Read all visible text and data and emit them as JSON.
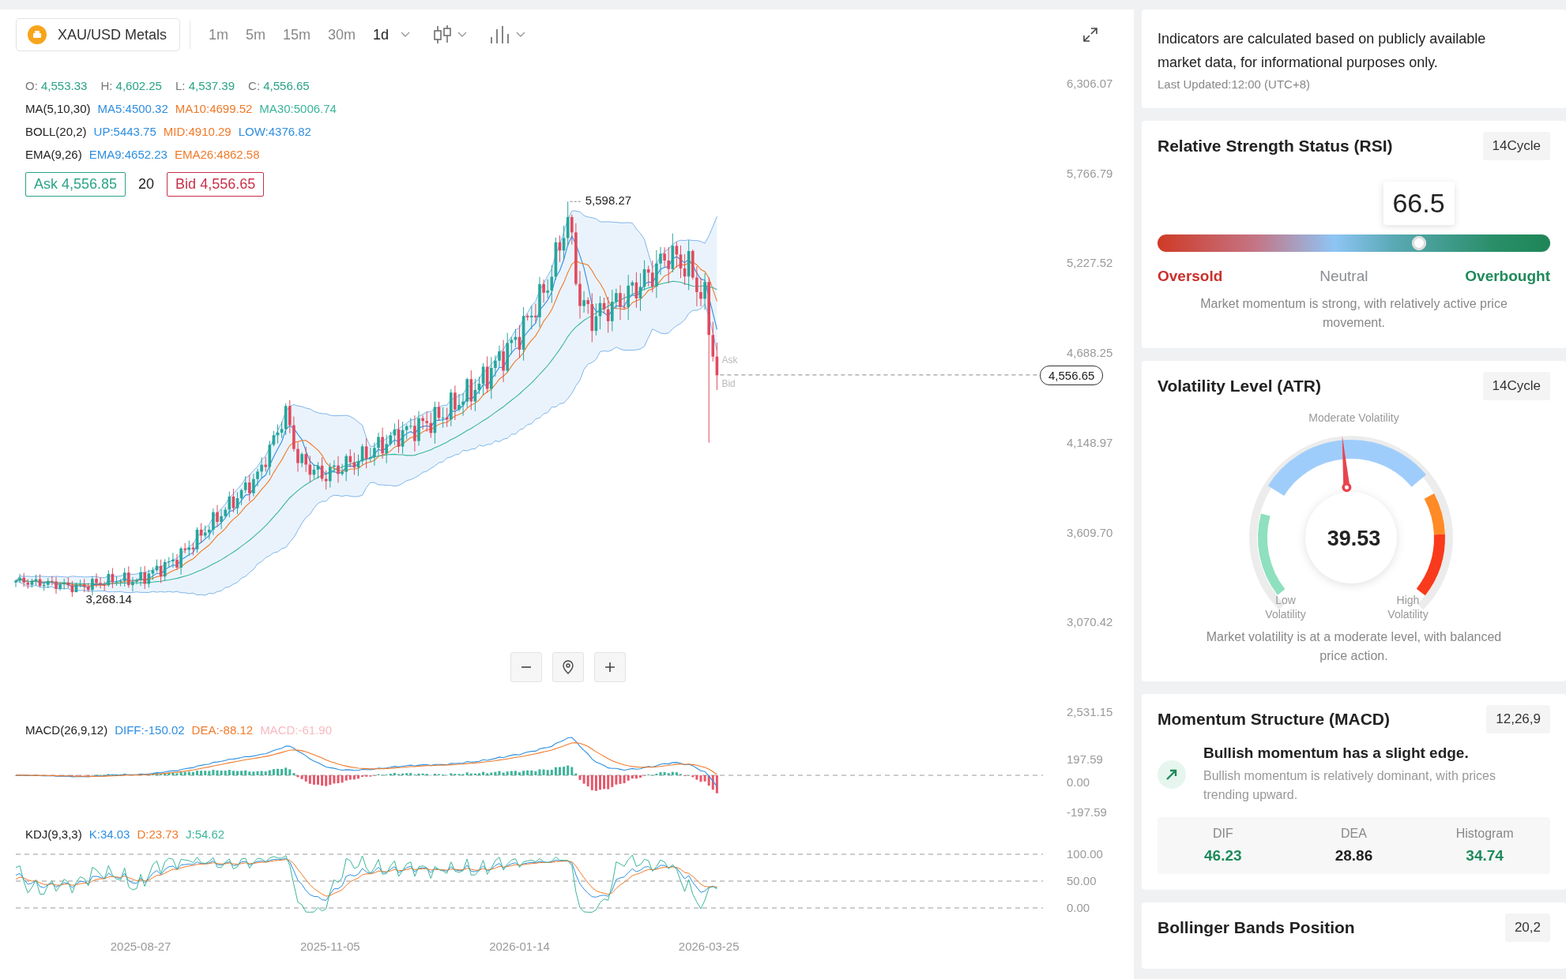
{
  "toolbar": {
    "symbol": "XAU/USD Metals",
    "intervals": [
      {
        "label": "1m",
        "selected": false
      },
      {
        "label": "5m",
        "selected": false
      },
      {
        "label": "15m",
        "selected": false
      },
      {
        "label": "30m",
        "selected": false
      },
      {
        "label": "1d",
        "selected": true
      }
    ]
  },
  "legend": {
    "ohlc": [
      {
        "label": "O:",
        "value": "4,553.33"
      },
      {
        "label": "H:",
        "value": "4,602.25"
      },
      {
        "label": "L:",
        "value": "4,537.39"
      },
      {
        "label": "C:",
        "value": "4,556.65"
      }
    ],
    "indicators": [
      {
        "name": "MA(5,10,30)",
        "values": [
          {
            "text": "MA5:4500.32",
            "color": "#2f8fe0"
          },
          {
            "text": "MA10:4699.52",
            "color": "#f07a2a"
          },
          {
            "text": "MA30:5006.74",
            "color": "#3bb59a"
          }
        ]
      },
      {
        "name": "BOLL(20,2)",
        "values": [
          {
            "text": "UP:5443.75",
            "color": "#2f8fe0"
          },
          {
            "text": "MID:4910.29",
            "color": "#f07a2a"
          },
          {
            "text": "LOW:4376.82",
            "color": "#2f8fe0"
          }
        ]
      },
      {
        "name": "EMA(9,26)",
        "values": [
          {
            "text": "EMA9:4652.23",
            "color": "#2f8fe0"
          },
          {
            "text": "EMA26:4862.58",
            "color": "#f07a2a"
          }
        ]
      }
    ]
  },
  "quote": {
    "ask": "Ask 4,556.85",
    "spread": "20",
    "bid": "Bid 4,556.65"
  },
  "chart": {
    "price_axis": [
      "6,306.07",
      "5,766.79",
      "5,227.52",
      "4,688.25",
      "4,148.97",
      "3,609.70",
      "3,070.42",
      "2,531.15"
    ],
    "high_label": "5,598.27",
    "low_label": "3,268.14",
    "current_price": "4,556.65",
    "ask_tag": "Ask",
    "bid_tag": "Bid"
  },
  "macd": {
    "name": "MACD(26,9,12)",
    "values": [
      {
        "text": "DIFF:-150.02",
        "color": "#2f8fe0"
      },
      {
        "text": "DEA:-88.12",
        "color": "#f07a2a"
      },
      {
        "text": "MACD:-61.90",
        "color": "#f7b9c1"
      }
    ],
    "axis": [
      "197.59",
      "0.00",
      "-197.59"
    ]
  },
  "kdj": {
    "name": "KDJ(9,3,3)",
    "values": [
      {
        "text": "K:34.03",
        "color": "#2f8fe0"
      },
      {
        "text": "D:23.73",
        "color": "#f07a2a"
      },
      {
        "text": "J:54.62",
        "color": "#3bb59a"
      }
    ],
    "axis": [
      "100.00",
      "50.00",
      "0.00"
    ]
  },
  "dates": [
    "2025-08-27",
    "2025-11-05",
    "2026-01-14",
    "2026-03-25"
  ],
  "note": {
    "text": "Indicators are calculated based on publicly available market data, for informational purposes only.",
    "updated": "Last Updated:12:00 (UTC+8)"
  },
  "rsi": {
    "title": "Relative Strength Status (RSI)",
    "badge": "14Cycle",
    "value": "66.5",
    "level": 0.665,
    "labels": [
      {
        "text": "Oversold",
        "color": "#c9302c"
      },
      {
        "text": "Neutral",
        "color": "#8a8d93"
      },
      {
        "text": "Overbought",
        "color": "#1e8a5a"
      }
    ],
    "description": "Market momentum is strong, with relatively active price movement."
  },
  "atr": {
    "title": "Volatility Level (ATR)",
    "badge": "14Cycle",
    "top_label": "Moderate Volatility",
    "low_label": "Low Volatility",
    "high_label": "High Volatility",
    "value": "39.53",
    "description": "Market volatility is at a moderate level, with balanced price action."
  },
  "macd_card": {
    "title": "Momentum Structure (MACD)",
    "badge": "12,26,9",
    "headline": "Bullish momentum has a slight edge.",
    "detail": "Bullish momentum is relatively dominant, with prices trending upward.",
    "stats": [
      {
        "label": "DIF",
        "value": "46.23",
        "color": "#1e8a5a"
      },
      {
        "label": "DEA",
        "value": "28.86",
        "color": "#222222"
      },
      {
        "label": "Histogram",
        "value": "34.74",
        "color": "#1e8a5a"
      }
    ]
  },
  "bollinger": {
    "title": "Bollinger Bands Position",
    "badge": "20,2"
  }
}
